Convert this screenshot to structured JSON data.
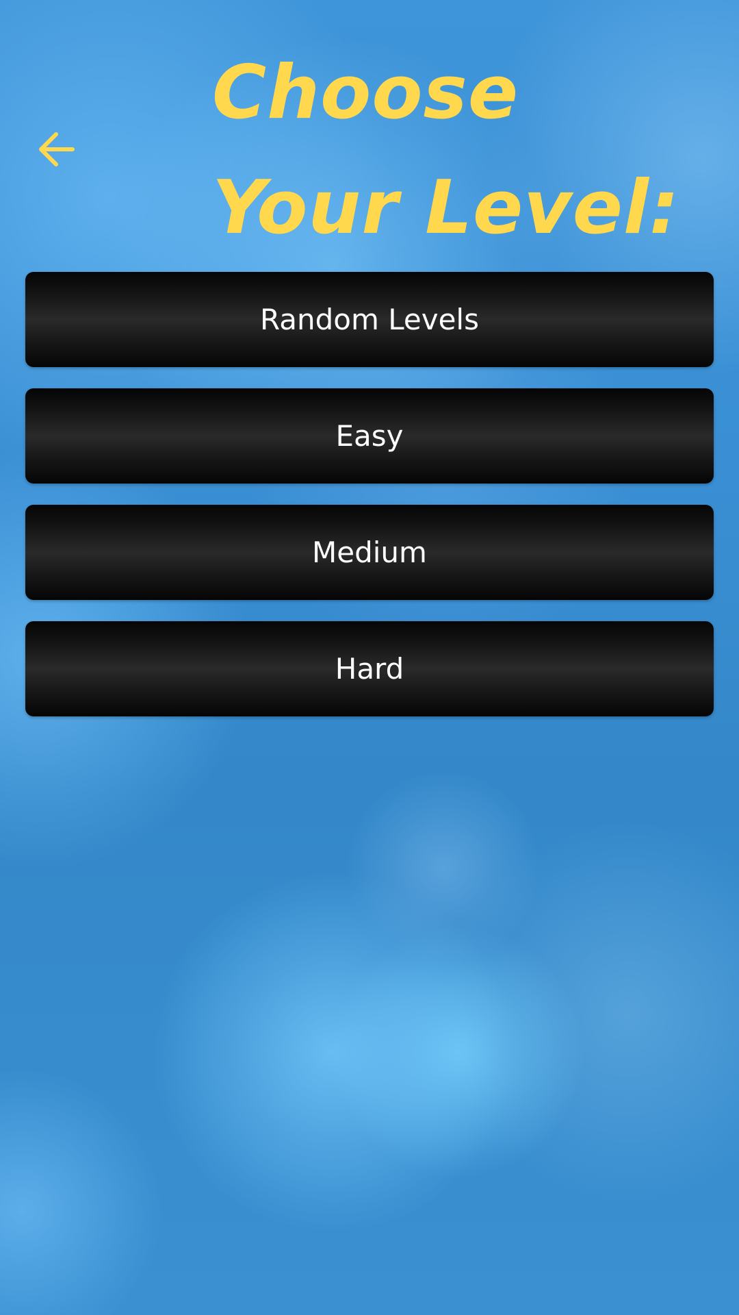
{
  "screen": {
    "title": "Choose Your Level:",
    "back_icon": "arrow-left-icon"
  },
  "levels": [
    {
      "label": "Random Levels"
    },
    {
      "label": "Easy"
    },
    {
      "label": "Medium"
    },
    {
      "label": "Hard"
    }
  ],
  "colors": {
    "title": "#ffd84d",
    "button_background": "#1a1a1a",
    "button_text": "#ffffff",
    "background": "#3a8fd4"
  }
}
